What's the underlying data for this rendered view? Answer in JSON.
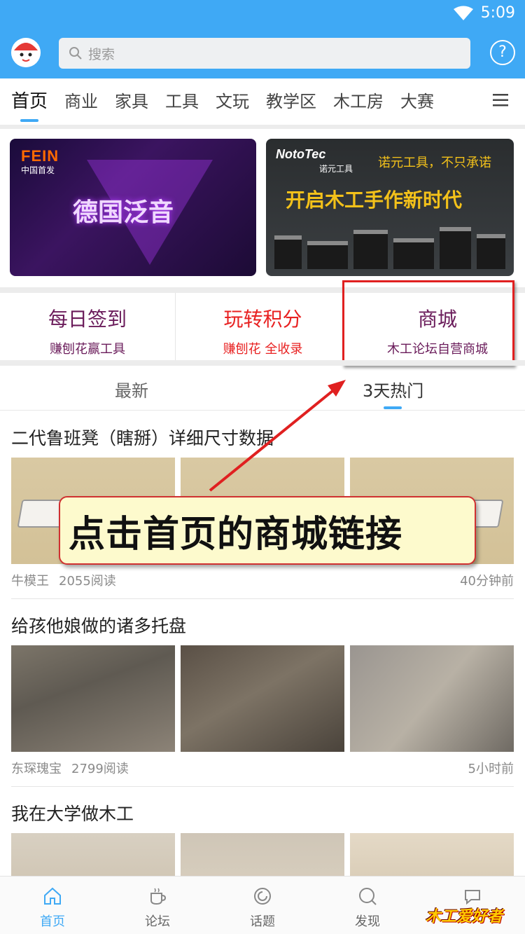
{
  "status": {
    "time": "5:09"
  },
  "header": {
    "search_placeholder": "搜索",
    "help_label": "?"
  },
  "nav": {
    "tabs": [
      "首页",
      "商业",
      "家具",
      "工具",
      "文玩",
      "教学区",
      "木工房",
      "大赛"
    ]
  },
  "banners": {
    "left": {
      "brand": "FEIN",
      "sub": "中国首发",
      "title": "德国泛音"
    },
    "right": {
      "brand": "NotoTec",
      "brand_cn": "诺元工具",
      "slogan": "诺元工具，不只承诺",
      "title": "开启木工手作新时代"
    }
  },
  "quick_links": [
    {
      "title": "每日签到",
      "subtitle": "赚刨花赢工具"
    },
    {
      "title": "玩转积分",
      "subtitle": "赚刨花 全收录"
    },
    {
      "title": "商城",
      "subtitle": "木工论坛自营商城"
    }
  ],
  "feed_tabs": [
    "最新",
    "3天热门"
  ],
  "posts": [
    {
      "title": "二代鲁班凳（瞎掰）详细尺寸数据",
      "author": "牛模王",
      "reads": "2055阅读",
      "time": "40分钟前"
    },
    {
      "title": "给孩他娘做的诸多托盘",
      "author": "东琛瑰宝",
      "reads": "2799阅读",
      "time": "5小时前"
    },
    {
      "title": "我在大学做木工",
      "author": "",
      "reads": "",
      "time": ""
    }
  ],
  "annotation": {
    "callout": "点击首页的商城链接"
  },
  "bottom_nav": [
    "首页",
    "论坛",
    "话题",
    "发现",
    ""
  ],
  "watermark": "木工爱好者",
  "colors": {
    "primary": "#3fa9f5",
    "annotation_red": "#e02020",
    "callout_bg": "#fdfacd"
  }
}
